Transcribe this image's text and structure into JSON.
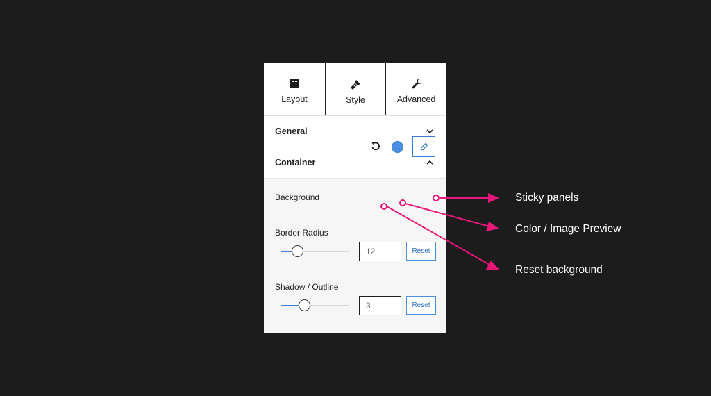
{
  "tabs": [
    {
      "label": "Layout",
      "icon": "layout-icon"
    },
    {
      "label": "Style",
      "icon": "brush-icon"
    },
    {
      "label": "Advanced",
      "icon": "wrench-icon"
    }
  ],
  "active_tab": "Style",
  "sections": {
    "general": {
      "title": "General",
      "state": "collapsed"
    },
    "container": {
      "title": "Container",
      "state": "expanded"
    }
  },
  "background": {
    "label": "Background",
    "preview_color": "#4a90e2",
    "reset_icon": "reset-icon",
    "edit_icon": "pencil-icon"
  },
  "border_radius": {
    "label": "Border Radius",
    "value": "12",
    "reset_label": "Reset",
    "slider_level": 0.24
  },
  "shadow": {
    "label": "Shadow / Outline",
    "value": "3",
    "reset_label": "Reset",
    "slider_level": 0.34
  },
  "callouts": {
    "sticky": "Sticky panels",
    "color": "Color / Image Preview",
    "reset": "Reset background"
  },
  "colors": {
    "accent": "#3b7dd0",
    "annotation": "#e8177a",
    "background": "#1c1c1c"
  }
}
